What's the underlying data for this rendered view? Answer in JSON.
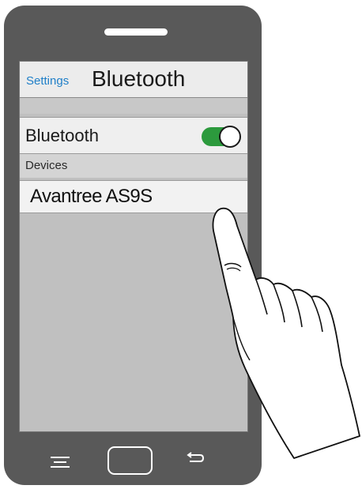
{
  "header": {
    "back_label": "Settings",
    "title": "Bluetooth"
  },
  "bluetooth": {
    "label": "Bluetooth",
    "enabled": true,
    "toggle_color": "#2c9a3d"
  },
  "devices": {
    "section_label": "Devices",
    "items": [
      {
        "name": "Avantree AS9S"
      }
    ]
  },
  "navbar": {
    "menu_icon": "menu-icon",
    "home_icon": "home-button",
    "back_icon": "back-icon"
  },
  "colors": {
    "phone_body": "#595959",
    "screen_bg": "#c0c0c0",
    "link": "#1f7fc8"
  }
}
